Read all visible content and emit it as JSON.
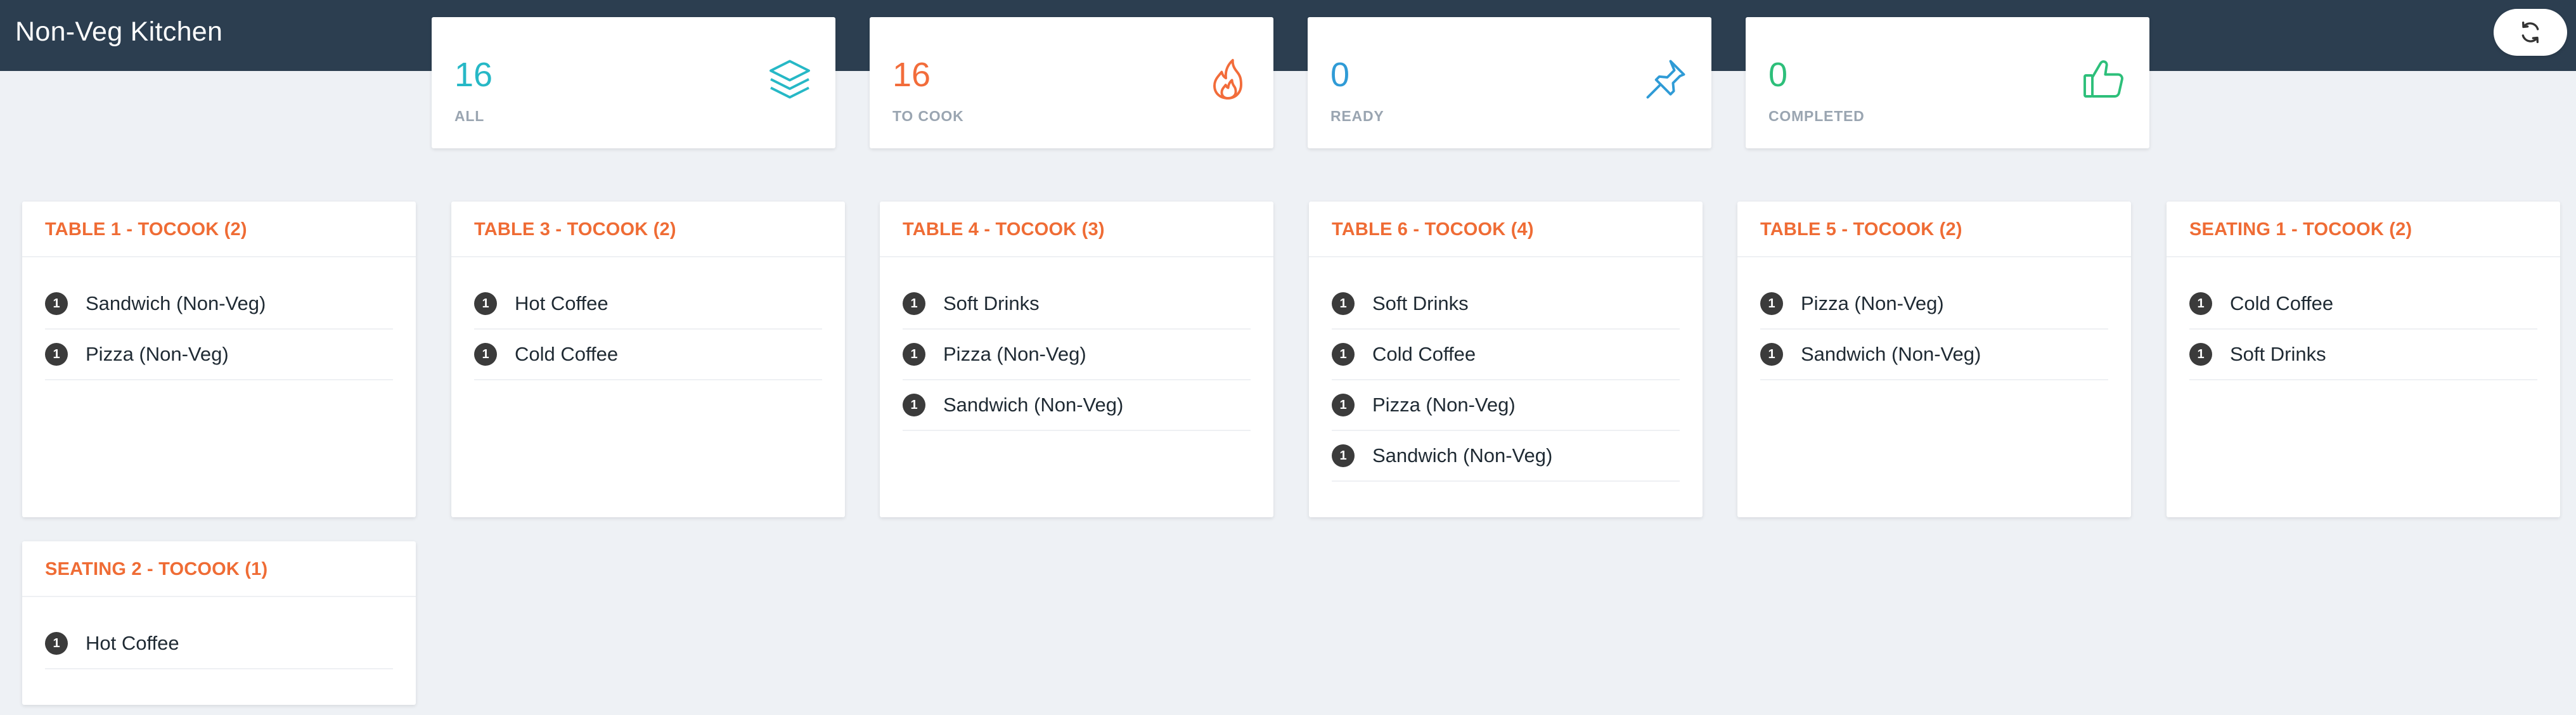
{
  "app": {
    "title": "Non-Veg Kitchen",
    "refresh_icon": "refresh-icon"
  },
  "stats": [
    {
      "value": "16",
      "label": "ALL",
      "icon": "layers-icon",
      "color": "#26b8c6"
    },
    {
      "value": "16",
      "label": "TO COOK",
      "icon": "fire-icon",
      "color": "#f26c3a"
    },
    {
      "value": "0",
      "label": "READY",
      "icon": "pin-icon",
      "color": "#2f9bd6"
    },
    {
      "value": "0",
      "label": "COMPLETED",
      "icon": "thumbs-up-icon",
      "color": "#2dbf7a"
    }
  ],
  "orders": [
    {
      "title": "TABLE 1 - TOCOOK (2)",
      "items": [
        {
          "qty": "1",
          "name": "Sandwich (Non-Veg)"
        },
        {
          "qty": "1",
          "name": "Pizza (Non-Veg)"
        }
      ]
    },
    {
      "title": "TABLE 3 - TOCOOK (2)",
      "items": [
        {
          "qty": "1",
          "name": "Hot Coffee"
        },
        {
          "qty": "1",
          "name": "Cold Coffee"
        }
      ]
    },
    {
      "title": "TABLE 4 - TOCOOK (3)",
      "items": [
        {
          "qty": "1",
          "name": "Soft Drinks"
        },
        {
          "qty": "1",
          "name": "Pizza (Non-Veg)"
        },
        {
          "qty": "1",
          "name": "Sandwich (Non-Veg)"
        }
      ]
    },
    {
      "title": "TABLE 6 - TOCOOK (4)",
      "items": [
        {
          "qty": "1",
          "name": "Soft Drinks"
        },
        {
          "qty": "1",
          "name": "Cold Coffee"
        },
        {
          "qty": "1",
          "name": "Pizza (Non-Veg)"
        },
        {
          "qty": "1",
          "name": "Sandwich (Non-Veg)"
        }
      ]
    },
    {
      "title": "TABLE 5 - TOCOOK (2)",
      "items": [
        {
          "qty": "1",
          "name": "Pizza (Non-Veg)"
        },
        {
          "qty": "1",
          "name": "Sandwich (Non-Veg)"
        }
      ]
    },
    {
      "title": "SEATING 1 - TOCOOK (2)",
      "items": [
        {
          "qty": "1",
          "name": "Cold Coffee"
        },
        {
          "qty": "1",
          "name": "Soft Drinks"
        }
      ]
    },
    {
      "title": "SEATING 2 - TOCOOK (1)",
      "items": [
        {
          "qty": "1",
          "name": "Hot Coffee"
        }
      ]
    }
  ]
}
